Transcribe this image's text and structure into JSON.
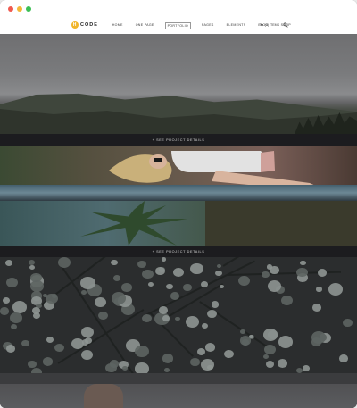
{
  "browser": {
    "controls": [
      "close",
      "minimize",
      "maximize"
    ]
  },
  "header": {
    "logo_mark": "H",
    "logo_text": "CODE",
    "nav": [
      "HOME",
      "ONE PAGE",
      "PORTFOLIO",
      "PAGES",
      "ELEMENTS",
      "BLOG",
      "SHOP"
    ],
    "active_nav": "PORTFOLIO",
    "cart": "(0) ITEMS",
    "icons": {
      "cart": "cart-icon",
      "search": "search-icon"
    }
  },
  "projects": [
    {
      "link": "+ SEE PROJECT DETAILS"
    },
    {
      "link": "+ SEE PROJECT DETAILS"
    }
  ],
  "colors": {
    "accent": "#f1b52a",
    "overlay": "#1c1c1f"
  }
}
